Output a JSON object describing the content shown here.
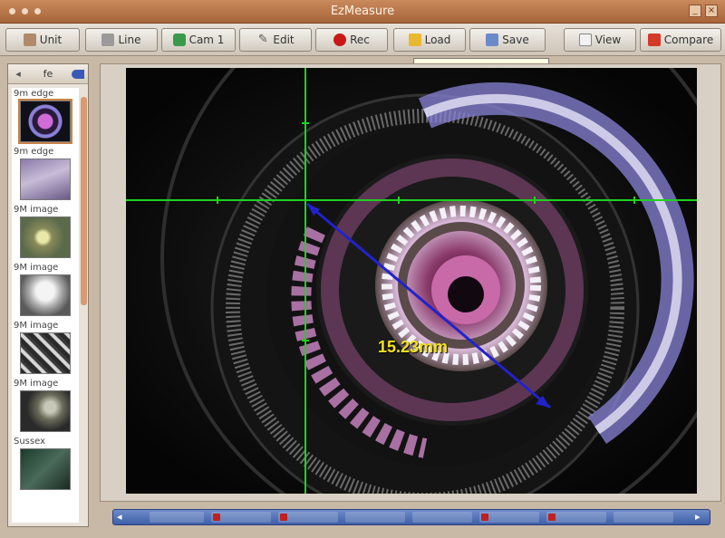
{
  "window": {
    "title": "EzMeasure"
  },
  "toolbar": {
    "buttons": [
      {
        "id": "unit",
        "label": "Unit"
      },
      {
        "id": "line",
        "label": "Line"
      },
      {
        "id": "camera",
        "label": "Cam 1"
      },
      {
        "id": "edit",
        "label": "Edit"
      },
      {
        "id": "rec",
        "label": "Rec"
      },
      {
        "id": "load",
        "label": "Load"
      },
      {
        "id": "save",
        "label": "Save"
      },
      {
        "id": "view",
        "label": "View"
      },
      {
        "id": "compare",
        "label": "Compare"
      }
    ]
  },
  "sidebar": {
    "header": "fe",
    "items": [
      {
        "label": "9m edge"
      },
      {
        "label": "9m edge"
      },
      {
        "label": "9M image"
      },
      {
        "label": "9M image"
      },
      {
        "label": "9M image"
      },
      {
        "label": "9M image"
      },
      {
        "label": "Sussex"
      }
    ],
    "selected_index": 0
  },
  "measurement": {
    "value": "15.23mm",
    "line_color": "#2222cc",
    "label_color": "#f4e21a"
  },
  "crosshair": {
    "color": "#1fd21f"
  },
  "colors": {
    "accent": "#c7824a",
    "bottombar": "#4a6ab4"
  }
}
